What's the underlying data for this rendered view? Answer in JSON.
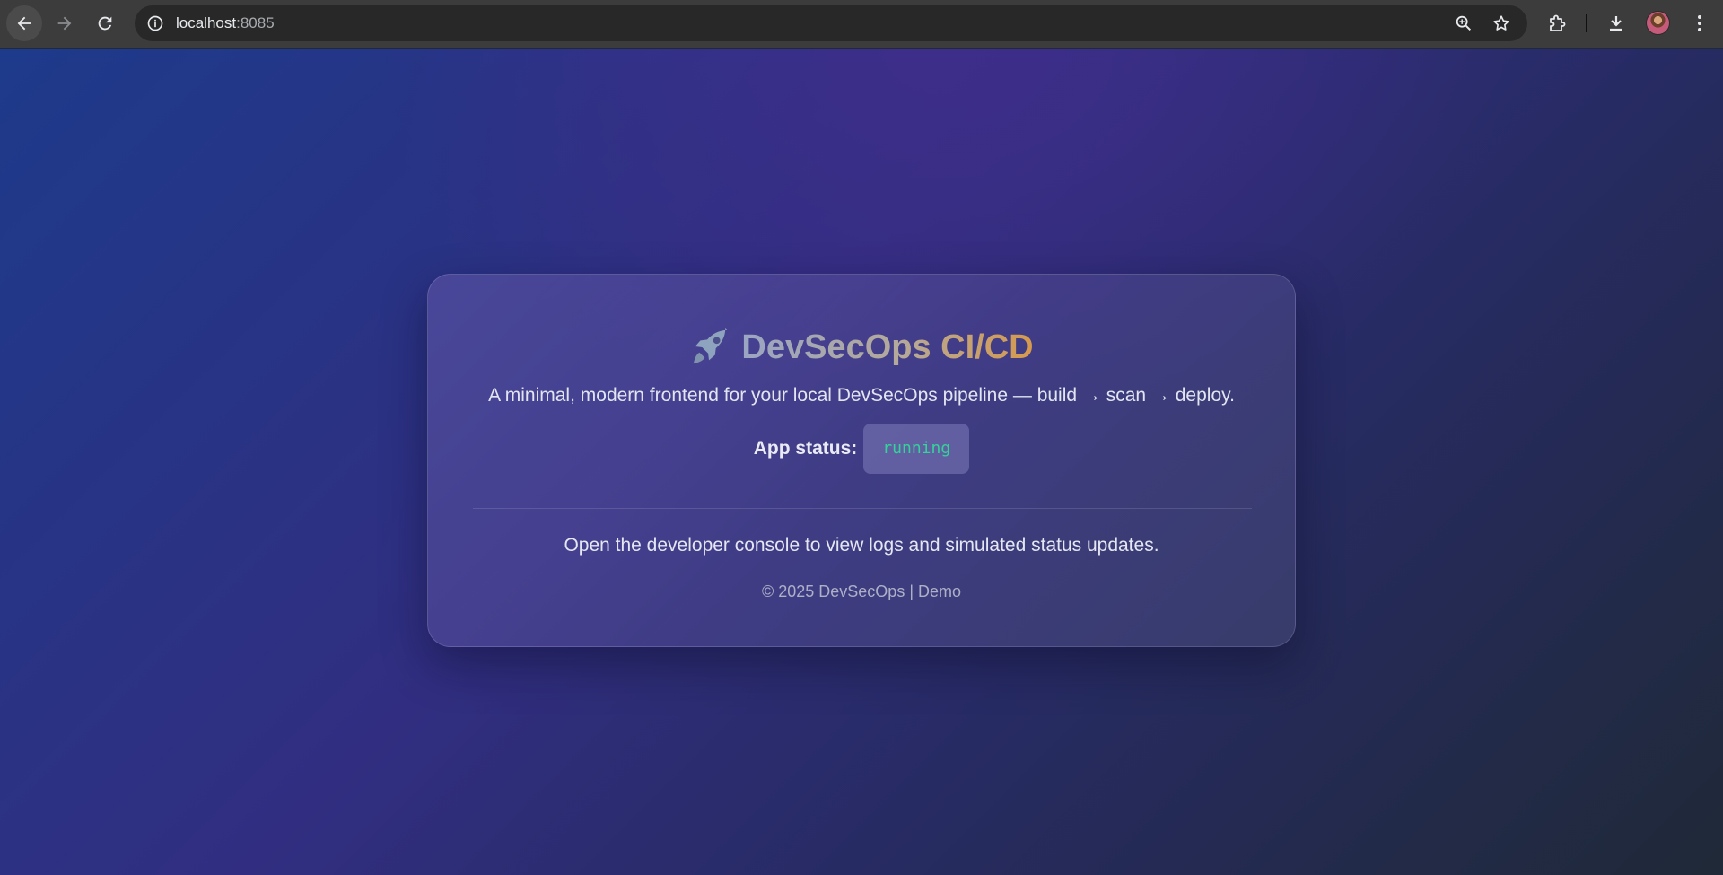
{
  "browser": {
    "url_host": "localhost",
    "url_port": ":8085"
  },
  "card": {
    "title": "DevSecOps CI/CD",
    "subtitle": "A minimal, modern frontend for your local DevSecOps pipeline — build → scan → deploy.",
    "status_label": "App status:",
    "status_value": "running",
    "hint": "Open the developer console to view logs and simulated status updates.",
    "footer": "© 2025 DevSecOps | Demo"
  },
  "colors": {
    "status_running": "#34d399",
    "title_gradient_start": "#9aa6c3",
    "title_gradient_end": "#d69a4c"
  },
  "icons": {
    "back": "arrow-left-icon",
    "forward": "arrow-right-icon",
    "reload": "reload-icon",
    "site_info": "info-icon",
    "zoom": "zoom-icon",
    "bookmark": "star-icon",
    "extensions": "puzzle-icon",
    "downloads": "download-icon",
    "profile": "avatar",
    "menu": "kebab-menu-icon",
    "title": "rocket-icon"
  }
}
